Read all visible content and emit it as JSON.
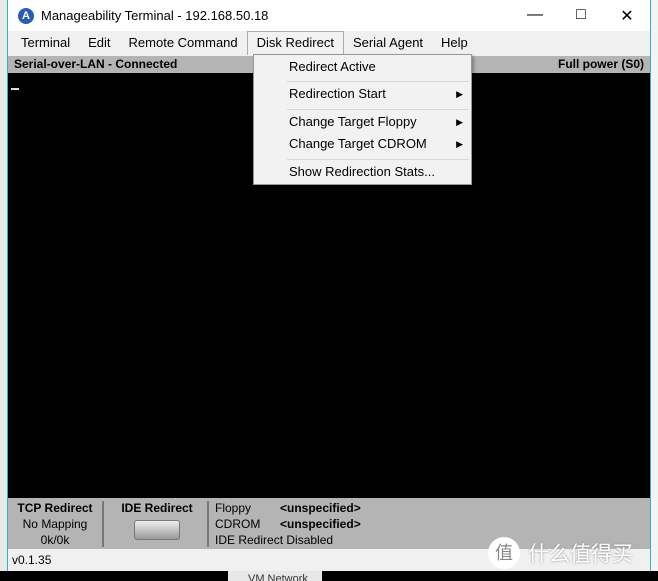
{
  "window": {
    "title": "Manageability Terminal - 192.168.50.18",
    "icon": "app-logo-icon"
  },
  "menu": [
    "Terminal",
    "Edit",
    "Remote Command",
    "Disk Redirect",
    "Serial Agent",
    "Help"
  ],
  "status": {
    "left": "Serial-over-LAN - Connected",
    "right": "Full power (S0)"
  },
  "dropdown": {
    "items": [
      "Redirect Active",
      "Redirection Start",
      "Change Target Floppy",
      "Change Target CDROM",
      "Show Redirection Stats..."
    ]
  },
  "panel": {
    "tcp_title": "TCP Redirect",
    "tcp_mapping": "No Mapping",
    "tcp_rate": "0k/0k",
    "ide_title": "IDE Redirect",
    "floppy_label": "Floppy",
    "floppy_value": "<unspecified>",
    "cdrom_label": "CDROM",
    "cdrom_value": "<unspecified>",
    "ide_state": "IDE Redirect Disabled"
  },
  "version": "v0.1.35",
  "background": {
    "vm_network": "VM Network",
    "watermark": "什么值得买",
    "watermark_logo": "值"
  }
}
